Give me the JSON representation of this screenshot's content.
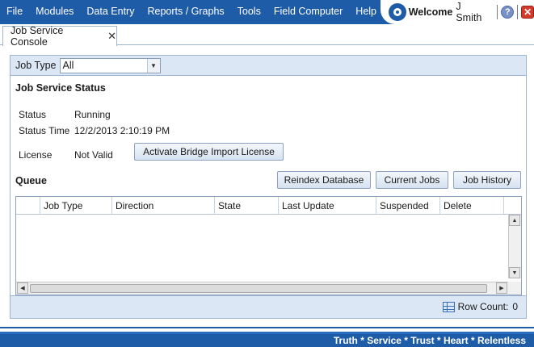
{
  "menu": {
    "items": [
      "File",
      "Modules",
      "Data Entry",
      "Reports / Graphs",
      "Tools",
      "Field Computer",
      "Help"
    ]
  },
  "user": {
    "welcome_label": "Welcome",
    "name": "J Smith",
    "help_icon": "?",
    "close_icon": "✕"
  },
  "tabs": [
    {
      "label": "Job Service Console",
      "close": "✕"
    }
  ],
  "filter": {
    "label": "Job Type",
    "value": "All"
  },
  "status_section": {
    "title": "Job Service Status",
    "status_label": "Status",
    "status_value": "Running",
    "time_label": "Status Time",
    "time_value": "12/2/2013 2:10:19 PM",
    "license_label": "License",
    "license_value": "Not Valid",
    "activate_button": "Activate Bridge Import License"
  },
  "queue": {
    "title": "Queue",
    "buttons": {
      "reindex": "Reindex Database",
      "current_jobs": "Current Jobs",
      "job_history": "Job History"
    },
    "columns": [
      "Job Type",
      "Direction",
      "State",
      "Last Update",
      "Suspended",
      "Delete"
    ],
    "rows": [],
    "row_count_label": "Row Count:",
    "row_count": "0"
  },
  "footer": {
    "tagline": "Truth * Service * Trust * Heart * Relentless"
  },
  "colors": {
    "brand_blue": "#1f5ca8",
    "panel_bar": "#dce7f5",
    "close_red": "#d43a2a"
  }
}
